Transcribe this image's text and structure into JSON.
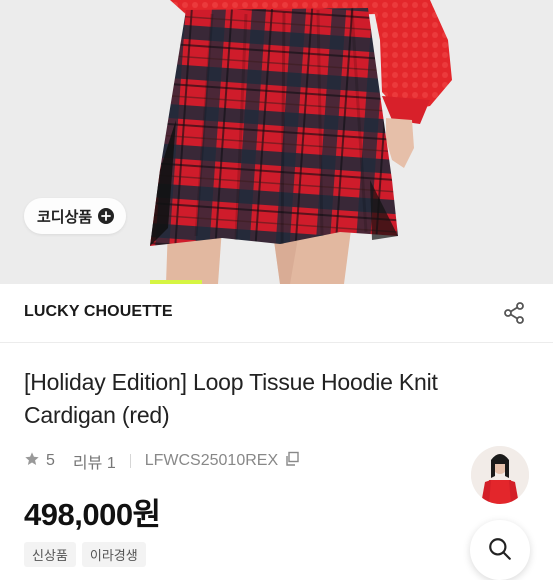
{
  "hero": {
    "coord_label": "코디상품",
    "coord_icon": "plus-circle-icon",
    "image_subject": "model wearing red and navy plaid pleated skirt"
  },
  "brand": {
    "name": "LUCKY CHOUETTE",
    "share_icon": "share-icon"
  },
  "product": {
    "title": "[Holiday Edition] Loop Tissue Hoodie Knit Cardigan (red)",
    "rating": "5",
    "review_label": "리뷰",
    "review_count": "1",
    "code": "LFWCS25010REX",
    "price": "498,000원"
  },
  "tags": [
    "신상품",
    "이라경생"
  ],
  "colors": {
    "plaid_red": "#d6192a",
    "plaid_navy": "#1f2a3a",
    "knit_red": "#e3262b",
    "text_dark": "#222222",
    "text_gray": "#888888"
  }
}
